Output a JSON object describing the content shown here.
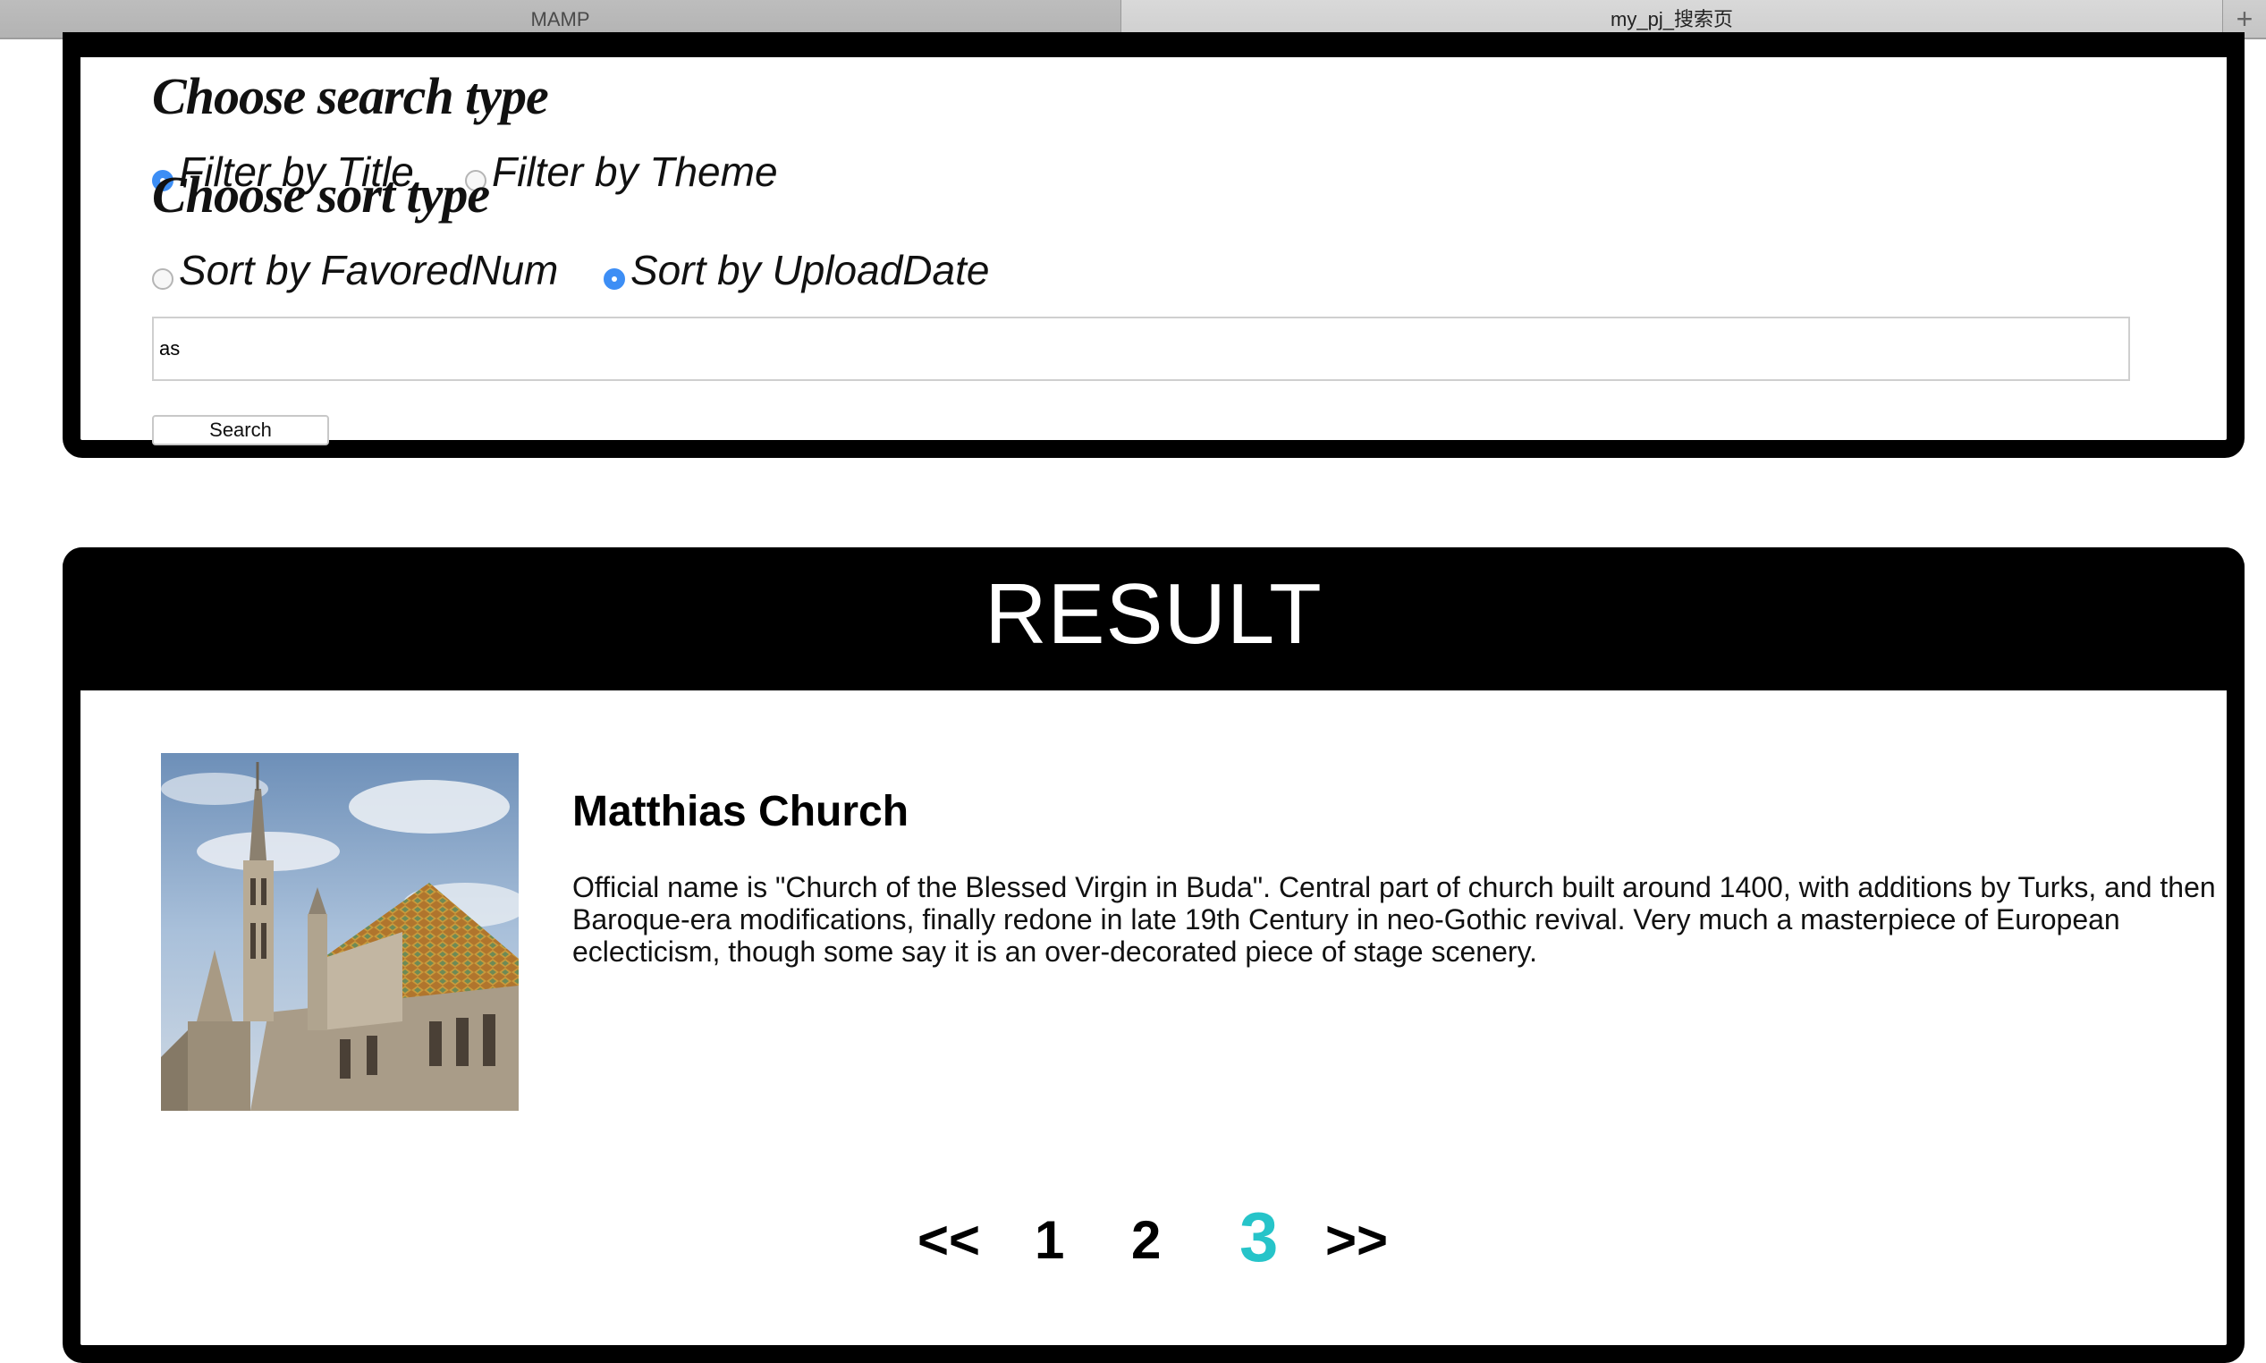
{
  "browser": {
    "tabs": [
      {
        "label": "MAMP",
        "active": false
      },
      {
        "label": "my_pj_搜索页",
        "active": true
      }
    ],
    "add_tab_icon": "plus-icon"
  },
  "search": {
    "search_type_heading": "Choose search type",
    "search_type_options": [
      {
        "label": "Filter by Title",
        "checked": true
      },
      {
        "label": "Filter by Theme",
        "checked": false
      }
    ],
    "sort_type_heading": "Choose sort type",
    "sort_type_options": [
      {
        "label": "Sort by FavoredNum",
        "checked": false
      },
      {
        "label": "Sort by UploadDate",
        "checked": true
      }
    ],
    "query_value": "as",
    "button_label": "Search"
  },
  "result": {
    "header": "RESULT",
    "items": [
      {
        "title": "Matthias Church",
        "description": "Official name is \"Church of the Blessed Virgin in Buda\". Central part of church built around 1400, with additions by Turks, and then Baroque-era modifications, finally redone in late 19th Century in neo-Gothic revival. Very much a masterpiece of European eclecticism, though some say it is an over-decorated piece of stage scenery."
      }
    ],
    "pagination": {
      "prev": "<<",
      "pages": [
        "1",
        "2",
        "3"
      ],
      "current": "3",
      "next": ">>"
    }
  },
  "colors": {
    "accent_current_page": "#26c4c9",
    "radio_checked": "#3d8ef5",
    "panel_border": "#000000"
  }
}
